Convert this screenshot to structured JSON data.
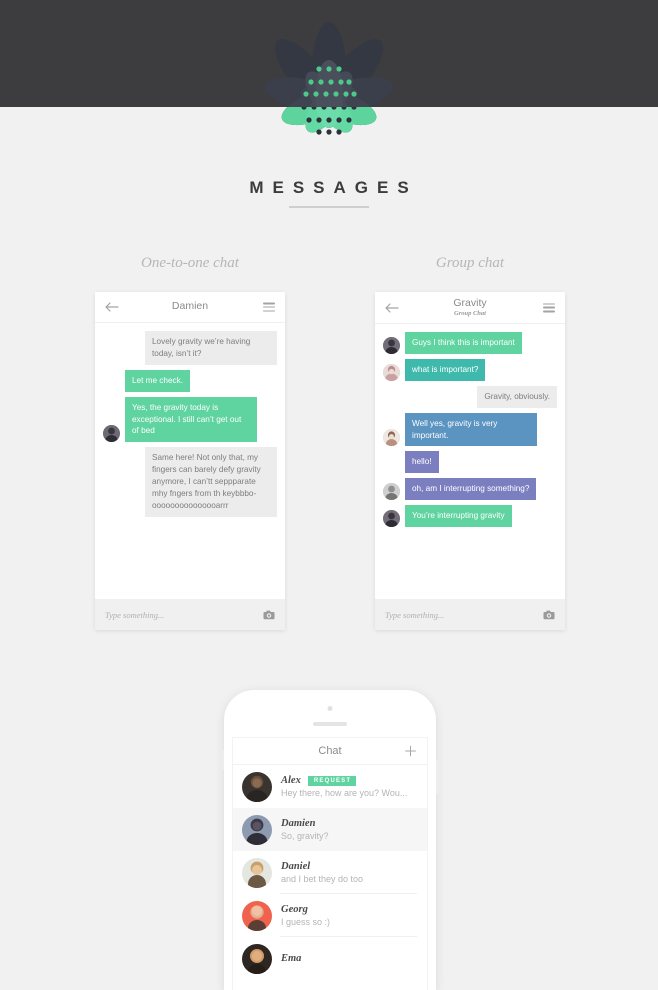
{
  "brand": {
    "wordmark": "MESSAGES",
    "logo_icon": "lotus-flower-icon",
    "dark_band_color": "#3d3d3f",
    "accent_green": "#5fd3a0",
    "page_background": "#f1f1f1"
  },
  "sections": {
    "one_to_one_label": "One-to-one chat",
    "group_label": "Group chat"
  },
  "one_to_one": {
    "header": {
      "title": "Damien",
      "back_icon": "back-arrow-icon",
      "menu_icon": "hamburger-menu-icon"
    },
    "messages": [
      {
        "side": "right",
        "color": "grey",
        "text": "Lovely gravity we’re having today, isn’t it?",
        "avatar": false
      },
      {
        "side": "left",
        "color": "green",
        "text": "Let me check.",
        "avatar": false
      },
      {
        "side": "left",
        "color": "green",
        "text": "Yes, the gravity today is exceptional. I still can’t get out of bed",
        "avatar": true
      },
      {
        "side": "right",
        "color": "grey",
        "text": "Same here! Not only that, my fingers can barely defy gravity anymore, I can’tt seppparate mhy fngers from th keybbbo-ooooooooooooooarrr",
        "avatar": false
      }
    ],
    "input": {
      "placeholder": "Type something...",
      "camera_icon": "camera-icon"
    }
  },
  "group_chat": {
    "header": {
      "title": "Gravity",
      "subtitle": "Group Chat",
      "back_icon": "back-arrow-icon",
      "menu_icon": "hamburger-menu-icon"
    },
    "messages": [
      {
        "side": "left",
        "color": "green",
        "text": "Guys I think this is important",
        "avatar": true
      },
      {
        "side": "left",
        "color": "teal",
        "text": "what is important?",
        "avatar": true
      },
      {
        "side": "right",
        "color": "grey",
        "text": "Gravity, obviously.",
        "avatar": false
      },
      {
        "side": "left",
        "color": "blue",
        "text": "Well yes, gravity is very important.",
        "avatar": true
      },
      {
        "side": "left",
        "color": "purple",
        "text": "hello!",
        "avatar": false
      },
      {
        "side": "left",
        "color": "purple",
        "text": "oh, am I interrupting something?",
        "avatar": true
      },
      {
        "side": "left",
        "color": "green",
        "text": "You’re interrupting gravity",
        "avatar": true
      }
    ],
    "input": {
      "placeholder": "Type something...",
      "camera_icon": "camera-icon"
    }
  },
  "phone": {
    "header": {
      "title": "Chat",
      "add_icon": "plus-icon"
    },
    "list": [
      {
        "name": "Alex",
        "preview": "Hey there, how are you? Wou...",
        "badge": "REQUEST",
        "selected": false
      },
      {
        "name": "Damien",
        "preview": "So, gravity?",
        "badge": "",
        "selected": true
      },
      {
        "name": "Daniel",
        "preview": "and I bet they do too",
        "badge": "",
        "selected": false
      },
      {
        "name": "Georg",
        "preview": "I guess so :)",
        "badge": "",
        "selected": false
      },
      {
        "name": "Ema",
        "preview": "",
        "badge": "",
        "selected": false
      }
    ]
  }
}
